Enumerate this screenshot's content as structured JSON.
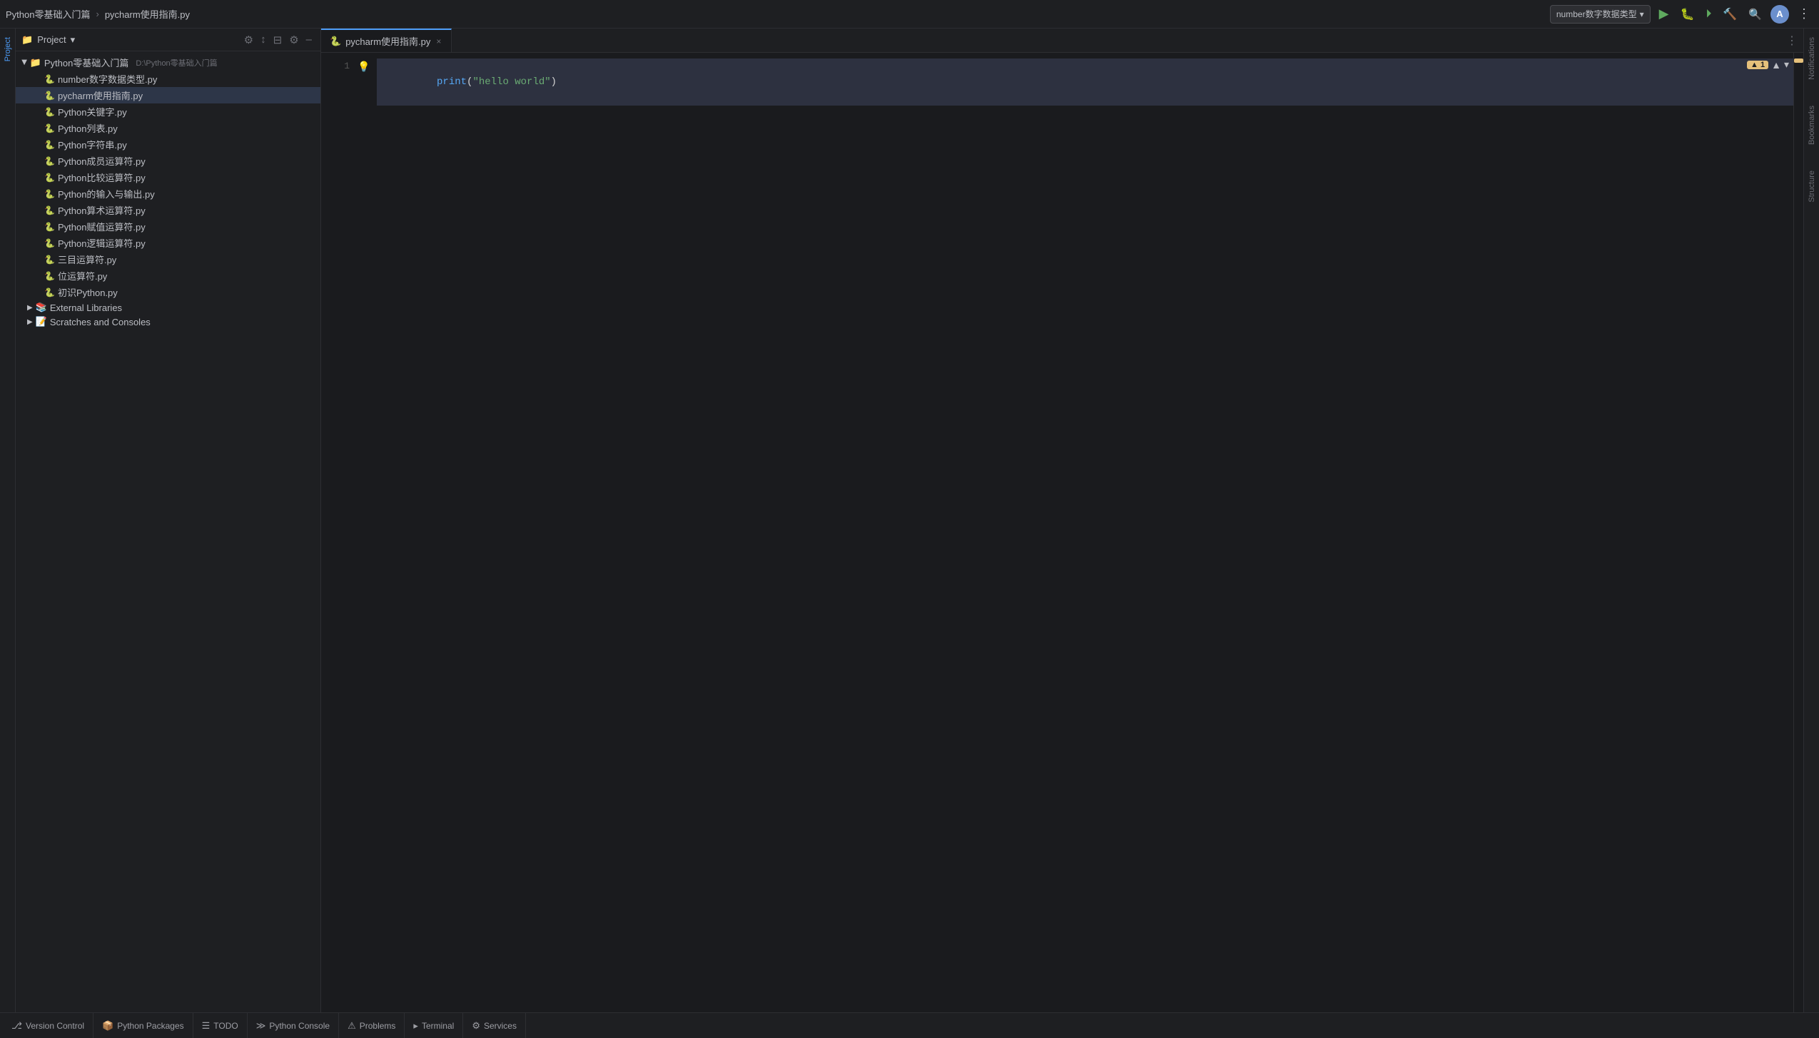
{
  "topbar": {
    "breadcrumb_project": "Python零基础入门篇",
    "breadcrumb_sep": "›",
    "breadcrumb_file": "pycharm使用指南.py",
    "run_config": "number数字数据类型",
    "run_config_dropdown": "▾"
  },
  "project_panel": {
    "title": "Project",
    "dropdown_icon": "▾",
    "root_folder": "Python零基础入门篇",
    "root_path": "D:\\Python零基础入门篇",
    "files": [
      {
        "name": "number数字数据类型.py",
        "indent": 2
      },
      {
        "name": "pycharm使用指南.py",
        "indent": 2,
        "active": true
      },
      {
        "name": "Python关键字.py",
        "indent": 2
      },
      {
        "name": "Python列表.py",
        "indent": 2
      },
      {
        "name": "Python字符串.py",
        "indent": 2
      },
      {
        "name": "Python成员运算符.py",
        "indent": 2
      },
      {
        "name": "Python比较运算符.py",
        "indent": 2
      },
      {
        "name": "Python的输入与输出.py",
        "indent": 2
      },
      {
        "name": "Python算术运算符.py",
        "indent": 2
      },
      {
        "name": "Python赋值运算符.py",
        "indent": 2
      },
      {
        "name": "Python逻辑运算符.py",
        "indent": 2
      },
      {
        "name": "三目运算符.py",
        "indent": 2
      },
      {
        "name": "位运算符.py",
        "indent": 2
      },
      {
        "name": "初识Python.py",
        "indent": 2
      }
    ],
    "external_libraries": "External Libraries",
    "scratches": "Scratches and Consoles"
  },
  "editor": {
    "tab_name": "pycharm使用指南.py",
    "warning_count": "▲ 1",
    "code_lines": [
      {
        "num": 1,
        "content": "print(\"hello world\")"
      }
    ]
  },
  "bottom_tabs": [
    {
      "label": "Version Control",
      "icon": "⎇"
    },
    {
      "label": "Python Packages",
      "icon": "📦"
    },
    {
      "label": "TODO",
      "icon": "☰"
    },
    {
      "label": "Python Console",
      "icon": "≫"
    },
    {
      "label": "Problems",
      "icon": "⚠"
    },
    {
      "label": "Terminal",
      "icon": "▸"
    },
    {
      "label": "Services",
      "icon": "⚙"
    }
  ],
  "right_sidebar": {
    "label": "Notifications"
  },
  "left_sidebar": {
    "label": "Project"
  },
  "icons": {
    "settings": "⚙",
    "sort": "↕",
    "collapse": "⊟",
    "gear": "⚙",
    "minimize": "–",
    "run": "▶",
    "debug": "🐛",
    "resume": "⏵",
    "build": "🔨",
    "search_everywhere": "🔍",
    "more_actions": "⋮",
    "chevron_down": "▾",
    "close": "×",
    "expand_right": "›",
    "bookmarks": "Bookmarks",
    "structure": "Structure"
  }
}
